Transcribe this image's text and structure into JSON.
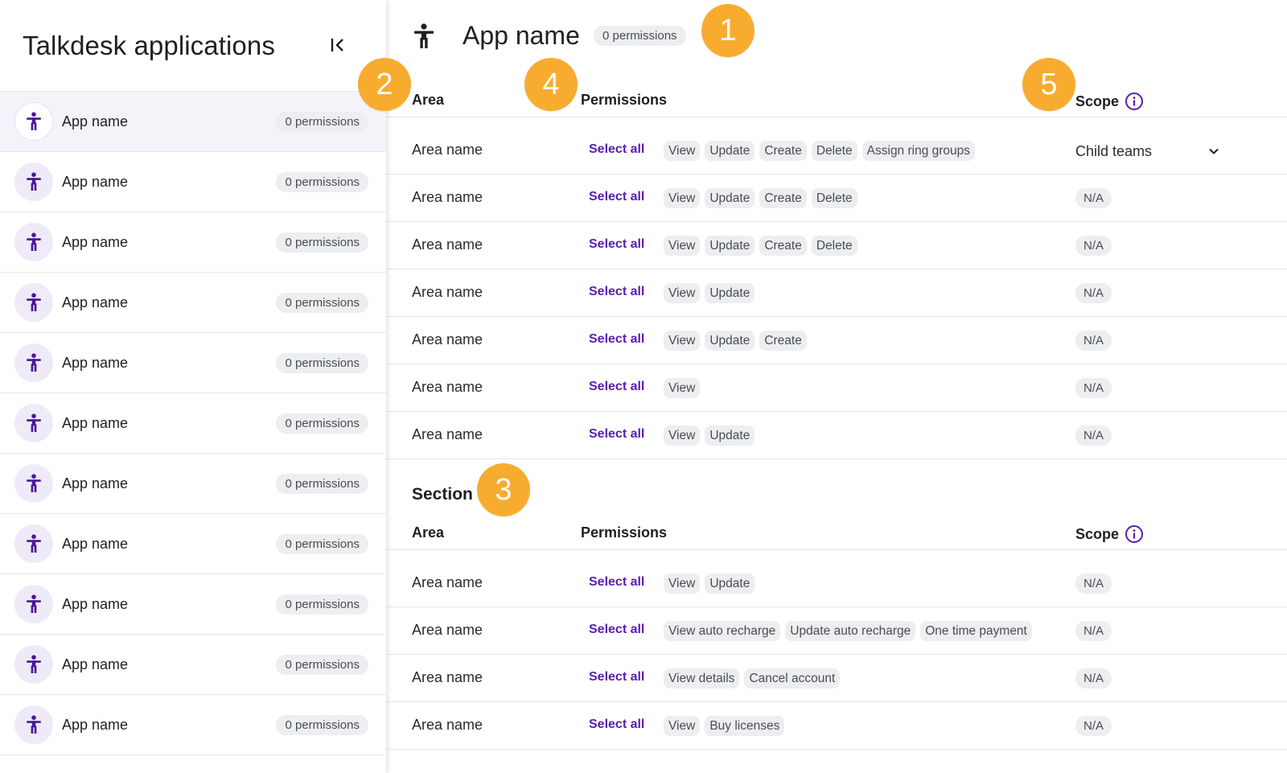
{
  "sidebar": {
    "title": "Talkdesk applications",
    "collapse_icon": "collapse-left-icon",
    "items": [
      {
        "label": "App name",
        "count": "0 permissions"
      },
      {
        "label": "App name",
        "count": "0 permissions"
      },
      {
        "label": "App name",
        "count": "0 permissions"
      },
      {
        "label": "App name",
        "count": "0 permissions"
      },
      {
        "label": "App name",
        "count": "0 permissions"
      },
      {
        "label": "App name",
        "count": "0 permissions"
      },
      {
        "label": "App name",
        "count": "0 permissions"
      },
      {
        "label": "App name",
        "count": "0 permissions"
      },
      {
        "label": "App name",
        "count": "0 permissions"
      },
      {
        "label": "App name",
        "count": "0 permissions"
      },
      {
        "label": "App name",
        "count": "0 permissions"
      }
    ]
  },
  "header": {
    "title": "App name",
    "count": "0 permissions",
    "icon": "accessibility-person-icon"
  },
  "table": {
    "col_area": "Area",
    "col_permissions": "Permissions",
    "col_scope": "Scope",
    "select_all": "Select all",
    "rows": [
      {
        "area": "Area name",
        "perms": [
          "View",
          "Update",
          "Create",
          "Delete",
          "Assign ring groups"
        ],
        "scope": "Child teams"
      },
      {
        "area": "Area name",
        "perms": [
          "View",
          "Update",
          "Create",
          "Delete"
        ],
        "scope": "N/A"
      },
      {
        "area": "Area name",
        "perms": [
          "View",
          "Update",
          "Create",
          "Delete"
        ],
        "scope": "N/A"
      },
      {
        "area": "Area name",
        "perms": [
          "View",
          "Update"
        ],
        "scope": "N/A"
      },
      {
        "area": "Area name",
        "perms": [
          "View",
          "Update",
          "Create"
        ],
        "scope": "N/A"
      },
      {
        "area": "Area name",
        "perms": [
          "View"
        ],
        "scope": "N/A"
      },
      {
        "area": "Area name",
        "perms": [
          "View",
          "Update"
        ],
        "scope": "N/A"
      }
    ]
  },
  "section": {
    "title": "Section",
    "col_area": "Area",
    "col_permissions": "Permissions",
    "col_scope": "Scope",
    "select_all": "Select all",
    "rows": [
      {
        "area": "Area name",
        "perms": [
          "View",
          "Update"
        ],
        "scope": "N/A"
      },
      {
        "area": "Area name",
        "perms": [
          "View auto recharge",
          "Update auto recharge",
          "One time payment"
        ],
        "scope": "N/A"
      },
      {
        "area": "Area name",
        "perms": [
          "View details",
          "Cancel account"
        ],
        "scope": "N/A"
      },
      {
        "area": "Area name",
        "perms": [
          "View",
          "Buy licenses"
        ],
        "scope": "N/A"
      }
    ]
  },
  "annotations": [
    "1",
    "2",
    "3",
    "4",
    "5"
  ],
  "colors": {
    "accent": "#5b1db0",
    "badge": "#f7ac2f",
    "chip_bg": "#eceef0",
    "avatar_bg": "#efeaf8",
    "active_row_bg": "#f5f3fa"
  }
}
